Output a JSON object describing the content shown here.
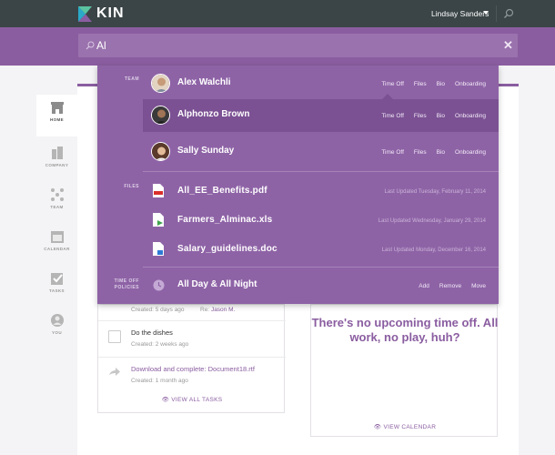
{
  "brand": {
    "name": "KIN"
  },
  "header": {
    "user_name": "Lindsay Sanders"
  },
  "search": {
    "value": "Al"
  },
  "sidebar": {
    "items": [
      {
        "label": "HOME",
        "icon": "home-icon"
      },
      {
        "label": "COMPANY",
        "icon": "company-icon"
      },
      {
        "label": "TEAM",
        "icon": "team-icon"
      },
      {
        "label": "CALENDAR",
        "icon": "calendar-icon"
      },
      {
        "label": "TASKS",
        "icon": "tasks-icon"
      },
      {
        "label": "YOU",
        "icon": "you-icon"
      }
    ]
  },
  "results": {
    "team_label": "TEAM",
    "files_label": "FILES",
    "timeoff_label": "TIME OFF POLICIES",
    "people": [
      {
        "name": "Alex Walchli",
        "actions": [
          "Time Off",
          "Files",
          "Bio",
          "Onboarding"
        ]
      },
      {
        "name": "Alphonzo Brown",
        "actions": [
          "Time Off",
          "Files",
          "Bio",
          "Onboarding"
        ]
      },
      {
        "name": "Sally Sunday",
        "actions": [
          "Time Off",
          "Files",
          "Bio",
          "Onboarding"
        ]
      }
    ],
    "files": [
      {
        "name": "All_EE_Benefits.pdf",
        "meta": "Last Updated Tuesday, February 11, 2014"
      },
      {
        "name": "Farmers_Alminac.xls",
        "meta": "Last Updated Wednesday, January 29, 2014"
      },
      {
        "name": "Salary_guidelines.doc",
        "meta": "Last Updated Monday, December 16, 2014"
      }
    ],
    "policy": {
      "name": "All Day & All Night",
      "actions": [
        "Add",
        "Remove",
        "Move"
      ]
    }
  },
  "tasks": {
    "first_created": "Created: 5 days ago",
    "first_re_label": "Re:",
    "first_re_name": "Jason M.",
    "items": [
      {
        "title": "Do the dishes",
        "sub": "Created: 2 weeks ago"
      },
      {
        "title": "Download and complete: Document18.rtf",
        "sub": "Created: 1 month ago"
      }
    ],
    "view_all": "VIEW ALL TASKS"
  },
  "calendar": {
    "message": "There's no upcoming time off. All work, no play, huh?",
    "view_all": "VIEW CALENDAR"
  },
  "colors": {
    "topbar": "#3b4547",
    "brand_purple": "#8a5da0",
    "dropdown": "#8e63a6",
    "highlight": "#7b5193"
  }
}
